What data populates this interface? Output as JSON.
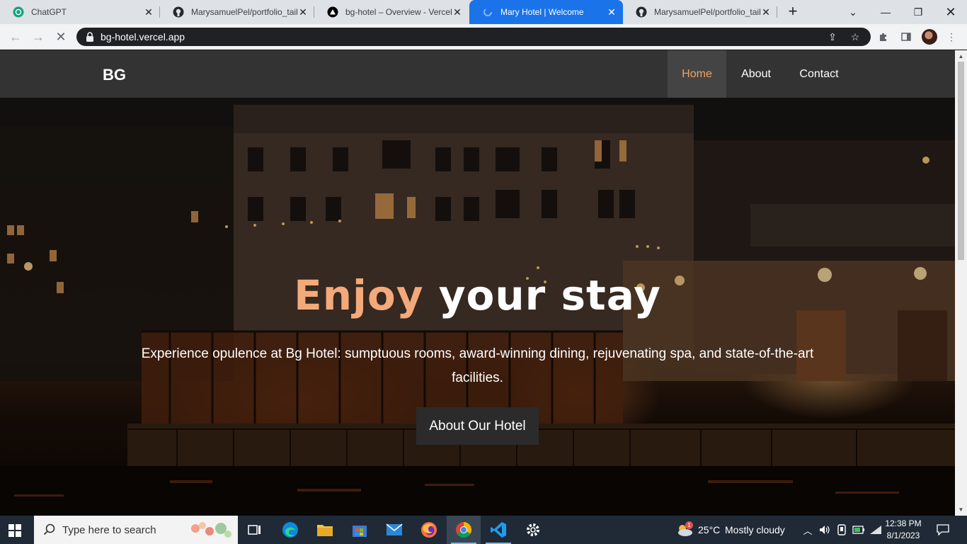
{
  "browser": {
    "tabs": [
      {
        "title": "ChatGPT",
        "favicon": "chatgpt-icon"
      },
      {
        "title": "MarysamuelPel/portfolio_tail",
        "favicon": "github-icon"
      },
      {
        "title": "bg-hotel – Overview - Vercel",
        "favicon": "vercel-icon"
      },
      {
        "title": "Mary Hotel | Welcome",
        "favicon": "page-icon",
        "active": true
      },
      {
        "title": "MarysamuelPel/portfolio_tail",
        "favicon": "github-icon"
      }
    ],
    "new_tab_label": "+",
    "url": "bg-hotel.vercel.app",
    "accent": "#1a73e8"
  },
  "site": {
    "brand": "BG",
    "nav": [
      {
        "label": "Home",
        "active": true
      },
      {
        "label": "About"
      },
      {
        "label": "Contact"
      }
    ],
    "accent": "#f4a261"
  },
  "hero": {
    "title_part1": "Enjoy",
    "title_part2": " your stay",
    "subtitle": "Experience opulence at Bg Hotel: sumptuous rooms, award-winning dining, rejuvenating spa, and state-of-the-art facilities.",
    "button": "About Our Hotel"
  },
  "taskbar": {
    "search_placeholder": "Type here to search",
    "apps": [
      "task-view-icon",
      "edge-icon",
      "file-explorer-icon",
      "store-icon",
      "mail-icon",
      "firefox-icon",
      "chrome-icon",
      "vscode-icon",
      "settings-icon"
    ],
    "weather_temp": "25°C",
    "weather_desc": "Mostly cloudy",
    "weather_badge": "1",
    "time": "12:38 PM",
    "date": "8/1/2023"
  }
}
